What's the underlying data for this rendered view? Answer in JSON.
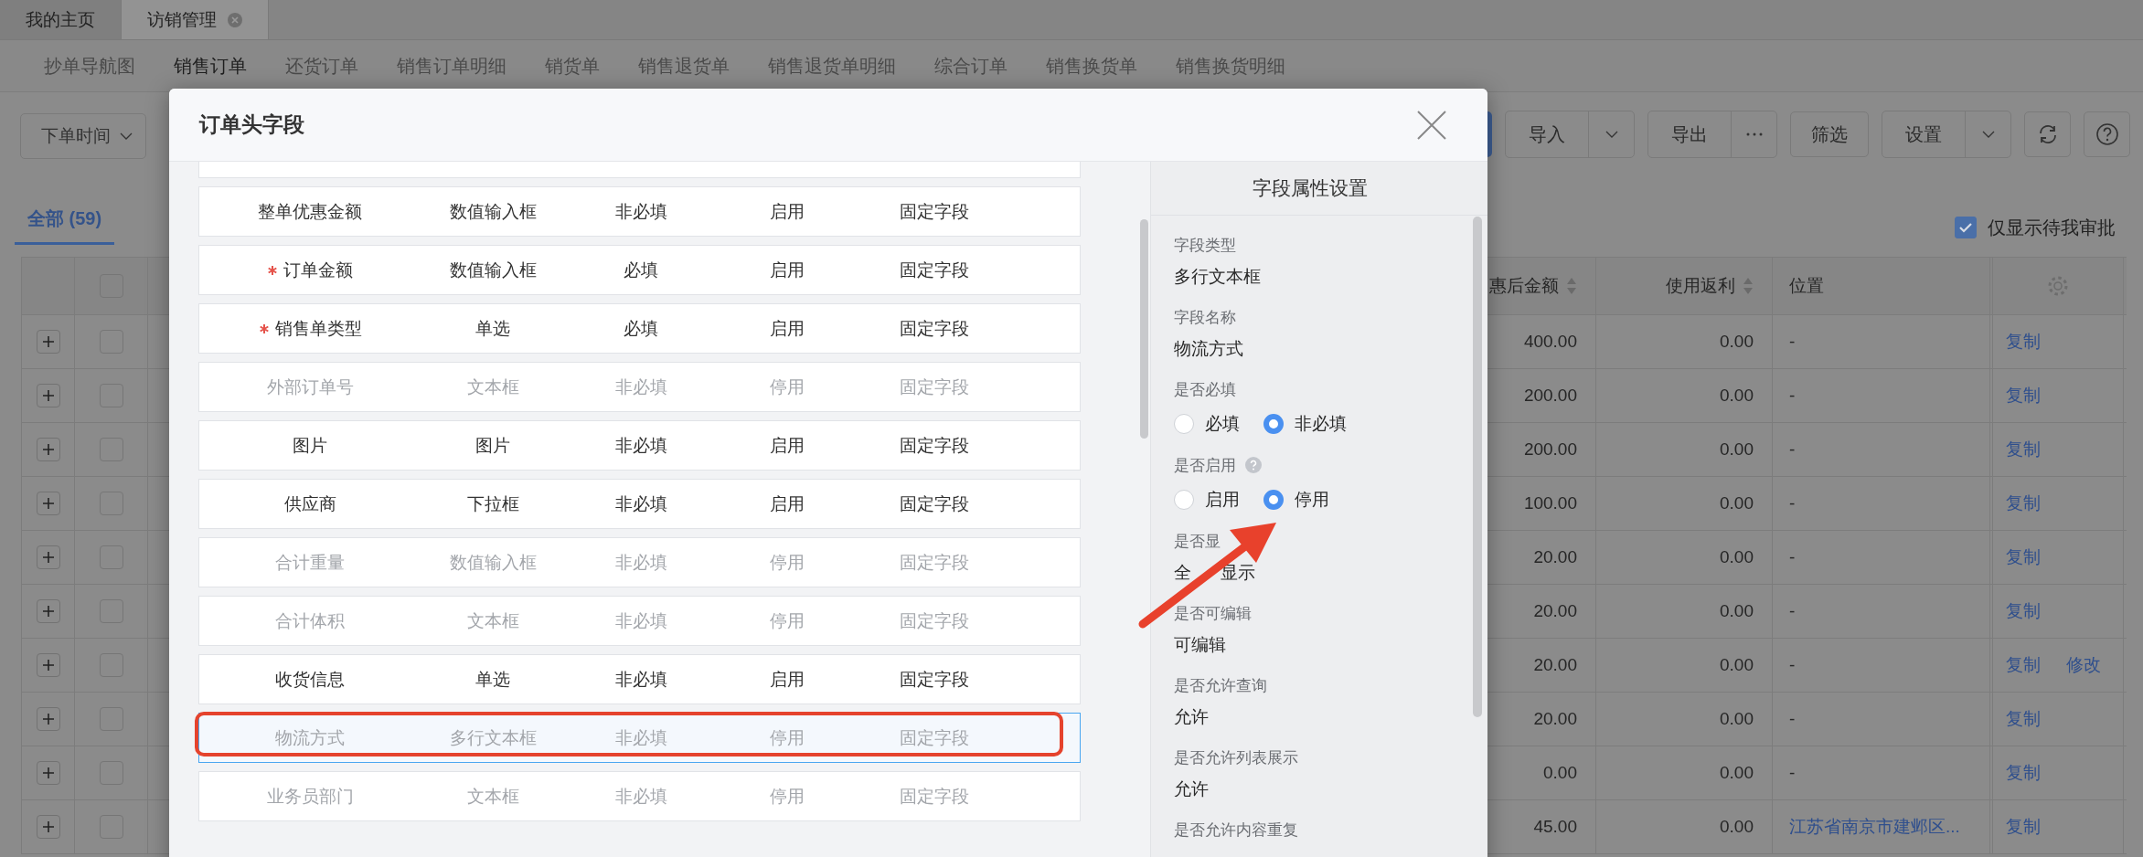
{
  "top_tabs": [
    {
      "label": "我的主页",
      "selected": false,
      "closable": false
    },
    {
      "label": "访销管理",
      "selected": true,
      "closable": true
    }
  ],
  "sub_nav": [
    {
      "label": "抄单导航图",
      "selected": false
    },
    {
      "label": "销售订单",
      "selected": true
    },
    {
      "label": "还货订单",
      "selected": false
    },
    {
      "label": "销售订单明细",
      "selected": false
    },
    {
      "label": "销货单",
      "selected": false
    },
    {
      "label": "销售退货单",
      "selected": false
    },
    {
      "label": "销售退货单明细",
      "selected": false
    },
    {
      "label": "综合订单",
      "selected": false
    },
    {
      "label": "销售换货单",
      "selected": false
    },
    {
      "label": "销售换货明细",
      "selected": false
    }
  ],
  "toolbar": {
    "date_filter": "下单时间",
    "buttons": [
      {
        "kind": "split",
        "label": "导入"
      },
      {
        "kind": "more",
        "label": "导出"
      },
      {
        "kind": "plain",
        "label": "筛选"
      },
      {
        "kind": "split",
        "label": "设置"
      },
      {
        "kind": "refresh"
      },
      {
        "kind": "help"
      }
    ]
  },
  "view_tabs": [
    {
      "label": "全部 (59)",
      "selected": true
    }
  ],
  "only_mine": {
    "label": "仅显示待我审批",
    "checked": true
  },
  "table": {
    "all_checked": false,
    "columns": [
      {
        "label": "惠后金额",
        "sortable": true
      },
      {
        "label": "使用返利",
        "sortable": true
      },
      {
        "label": "位置",
        "sortable": false
      }
    ],
    "rows": [
      {
        "checked": false,
        "amount": "400.00",
        "rebate": "0.00",
        "location": "-",
        "location_link": false,
        "actions": [
          "复制"
        ]
      },
      {
        "checked": false,
        "amount": "200.00",
        "rebate": "0.00",
        "location": "-",
        "location_link": false,
        "actions": [
          "复制"
        ]
      },
      {
        "checked": false,
        "amount": "200.00",
        "rebate": "0.00",
        "location": "-",
        "location_link": false,
        "actions": [
          "复制"
        ]
      },
      {
        "checked": false,
        "amount": "100.00",
        "rebate": "0.00",
        "location": "-",
        "location_link": false,
        "actions": [
          "复制"
        ]
      },
      {
        "checked": false,
        "amount": "20.00",
        "rebate": "0.00",
        "location": "-",
        "location_link": false,
        "actions": [
          "复制"
        ]
      },
      {
        "checked": false,
        "amount": "20.00",
        "rebate": "0.00",
        "location": "-",
        "location_link": false,
        "actions": [
          "复制"
        ]
      },
      {
        "checked": false,
        "amount": "20.00",
        "rebate": "0.00",
        "location": "-",
        "location_link": false,
        "actions": [
          "复制",
          "修改"
        ]
      },
      {
        "checked": false,
        "amount": "20.00",
        "rebate": "0.00",
        "location": "-",
        "location_link": false,
        "actions": [
          "复制"
        ]
      },
      {
        "checked": false,
        "amount": "0.00",
        "rebate": "0.00",
        "location": "-",
        "location_link": false,
        "actions": [
          "复制"
        ]
      },
      {
        "checked": false,
        "amount": "45.00",
        "rebate": "0.00",
        "location": "江苏省南京市建邺区...",
        "location_link": true,
        "actions": [
          "复制"
        ]
      }
    ]
  },
  "modal": {
    "title": "订单头字段",
    "fields": [
      {
        "name": "整单优惠金额",
        "type": "数值输入框",
        "required_text": "非必填",
        "status": "启用",
        "source": "固定字段",
        "required": false,
        "enabled": true,
        "selected": false
      },
      {
        "name": "订单金额",
        "type": "数值输入框",
        "required_text": "必填",
        "status": "启用",
        "source": "固定字段",
        "required": true,
        "enabled": true,
        "selected": false
      },
      {
        "name": "销售单类型",
        "type": "单选",
        "required_text": "必填",
        "status": "启用",
        "source": "固定字段",
        "required": true,
        "enabled": true,
        "selected": false
      },
      {
        "name": "外部订单号",
        "type": "文本框",
        "required_text": "非必填",
        "status": "停用",
        "source": "固定字段",
        "required": false,
        "enabled": false,
        "selected": false
      },
      {
        "name": "图片",
        "type": "图片",
        "required_text": "非必填",
        "status": "启用",
        "source": "固定字段",
        "required": false,
        "enabled": true,
        "selected": false
      },
      {
        "name": "供应商",
        "type": "下拉框",
        "required_text": "非必填",
        "status": "启用",
        "source": "固定字段",
        "required": false,
        "enabled": true,
        "selected": false
      },
      {
        "name": "合计重量",
        "type": "数值输入框",
        "required_text": "非必填",
        "status": "停用",
        "source": "固定字段",
        "required": false,
        "enabled": false,
        "selected": false
      },
      {
        "name": "合计体积",
        "type": "文本框",
        "required_text": "非必填",
        "status": "停用",
        "source": "固定字段",
        "required": false,
        "enabled": false,
        "selected": false
      },
      {
        "name": "收货信息",
        "type": "单选",
        "required_text": "非必填",
        "status": "启用",
        "source": "固定字段",
        "required": false,
        "enabled": true,
        "selected": false
      },
      {
        "name": "物流方式",
        "type": "多行文本框",
        "required_text": "非必填",
        "status": "停用",
        "source": "固定字段",
        "required": false,
        "enabled": false,
        "selected": true
      },
      {
        "name": "业务员部门",
        "type": "文本框",
        "required_text": "非必填",
        "status": "停用",
        "source": "固定字段",
        "required": false,
        "enabled": false,
        "selected": false
      }
    ],
    "properties": {
      "title": "字段属性设置",
      "items": [
        {
          "kind": "text",
          "label": "字段类型",
          "value": "多行文本框"
        },
        {
          "kind": "text",
          "label": "字段名称",
          "value": "物流方式"
        },
        {
          "kind": "radio",
          "label": "是否必填",
          "help": false,
          "options": [
            {
              "label": "必填",
              "selected": false
            },
            {
              "label": "非必填",
              "selected": true
            }
          ]
        },
        {
          "kind": "radio",
          "label": "是否启用",
          "help": true,
          "options": [
            {
              "label": "启用",
              "selected": false
            },
            {
              "label": "停用",
              "selected": true
            }
          ]
        },
        {
          "kind": "covered",
          "label": "是否显",
          "values": [
            "全",
            "显示"
          ]
        },
        {
          "kind": "text",
          "label": "是否可编辑",
          "value": "可编辑"
        },
        {
          "kind": "text",
          "label": "是否允许查询",
          "value": "允许"
        },
        {
          "kind": "text",
          "label": "是否允许列表展示",
          "value": "允许"
        },
        {
          "kind": "label",
          "label": "是否允许内容重复"
        }
      ]
    }
  }
}
